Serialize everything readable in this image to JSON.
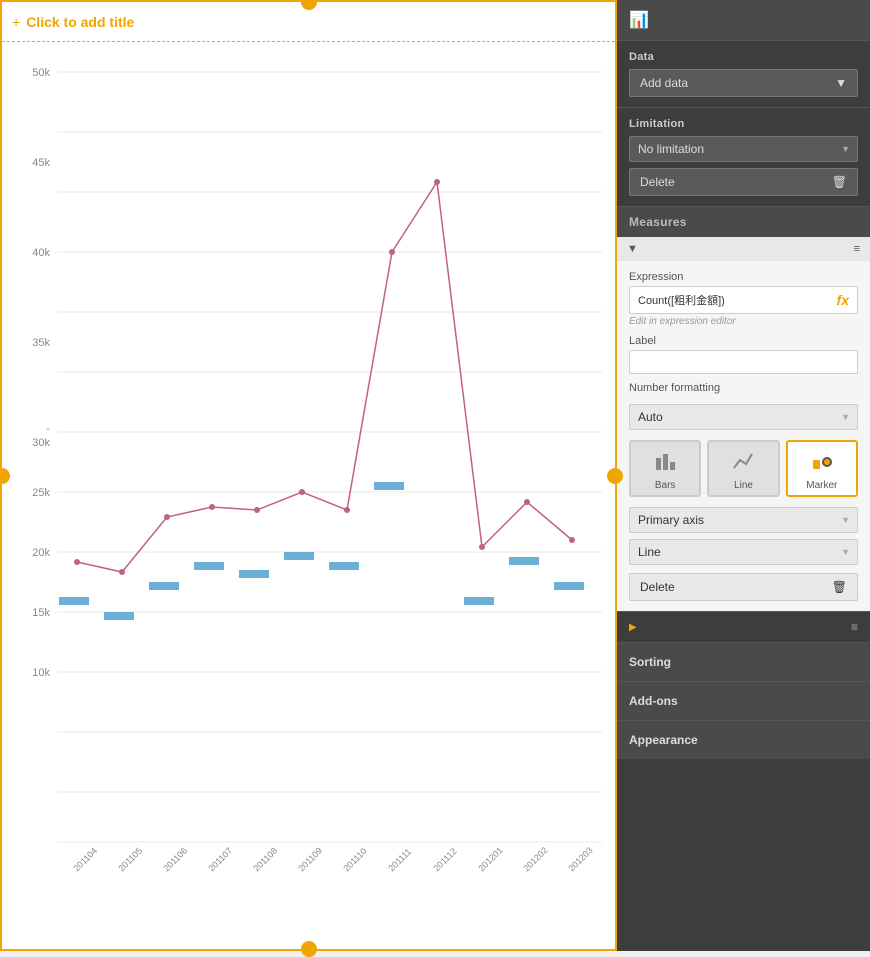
{
  "chart": {
    "title": "Click to add title",
    "title_icon": "+",
    "y_axis": [
      "50k",
      "45k",
      "40k",
      "35k",
      "30k",
      "25k",
      "20k",
      "15k",
      "10k"
    ],
    "x_axis": [
      "201104",
      "201105",
      "201106",
      "201107",
      "201108",
      "201109",
      "201110",
      "201111",
      "201112",
      "201201",
      "201202",
      "201203"
    ],
    "dash_label": "-"
  },
  "panel": {
    "icon": "📊",
    "data_section": {
      "label": "Data",
      "add_data_label": "Add data",
      "add_data_arrow": "▼"
    },
    "limitation_section": {
      "label": "Limitation",
      "options": [
        "No limitation"
      ],
      "selected": "No limitation"
    },
    "delete_button": "Delete",
    "delete_icon": "🗑",
    "measures_section": {
      "label": "Measures",
      "collapse_icon": "▼",
      "menu_icon": "≡",
      "expression_label": "Expression",
      "expression_value": "Count([粗利金額])",
      "expression_fx": "fx",
      "edit_link": "Edit in expression editor",
      "label_field": "Label",
      "label_value": "",
      "number_formatting_label": "Number formatting",
      "number_formatting_options": [
        "Auto"
      ],
      "number_formatting_selected": "Auto",
      "chart_types": [
        {
          "id": "bars",
          "label": "Bars",
          "icon": "▐"
        },
        {
          "id": "line",
          "label": "Line",
          "icon": "📈"
        },
        {
          "id": "marker",
          "label": "Marker",
          "active": true,
          "icon": "⬤"
        }
      ],
      "primary_axis_label": "Primary axis",
      "primary_axis_options": [
        "Primary axis"
      ],
      "primary_axis_selected": "Primary axis",
      "line_type_options": [
        "Line"
      ],
      "line_type_selected": "Line",
      "delete_button": "Delete",
      "delete_icon": "🗑"
    },
    "second_collapse": {
      "icon": "▶",
      "menu_icon": "≡"
    },
    "sorting_label": "Sorting",
    "addons_label": "Add-ons",
    "appearance_label": "Appearance"
  }
}
